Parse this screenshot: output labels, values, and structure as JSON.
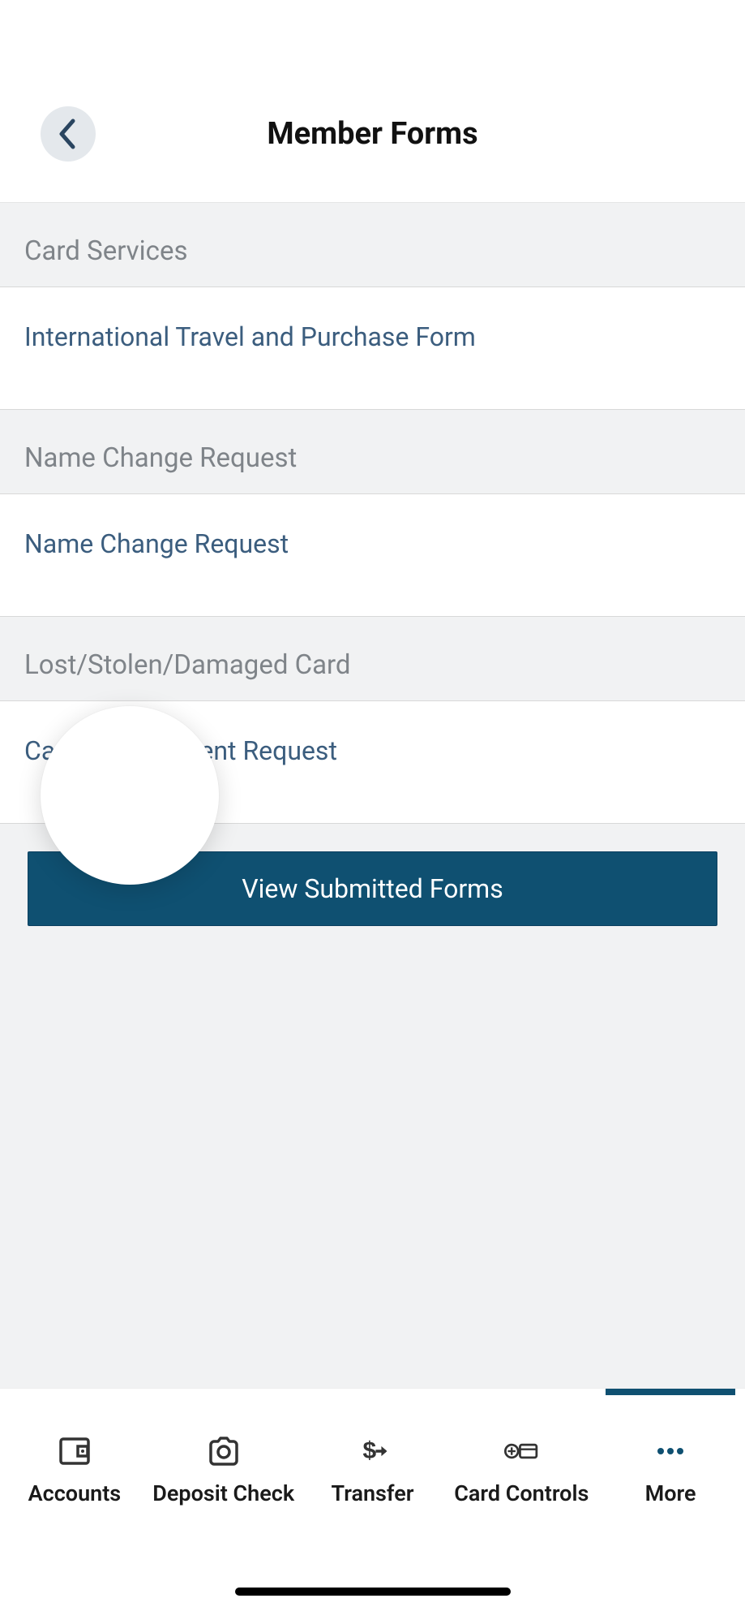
{
  "header": {
    "title": "Member Forms"
  },
  "sections": [
    {
      "header": "Card Services",
      "items": [
        "International Travel and Purchase Form"
      ]
    },
    {
      "header": "Name Change Request",
      "items": [
        "Name Change Request"
      ]
    },
    {
      "header": "Lost/Stolen/Damaged Card",
      "items": [
        "Card Replacement Request"
      ]
    }
  ],
  "button": {
    "view_submitted": "View Submitted Forms"
  },
  "nav": {
    "accounts": "Accounts",
    "deposit": "Deposit Check",
    "transfer": "Transfer",
    "card_controls": "Card Controls",
    "more": "More"
  },
  "colors": {
    "accent": "#0f5071",
    "link": "#3b5d7e",
    "section_text": "#7f8489",
    "bg_grey": "#f1f2f3"
  }
}
